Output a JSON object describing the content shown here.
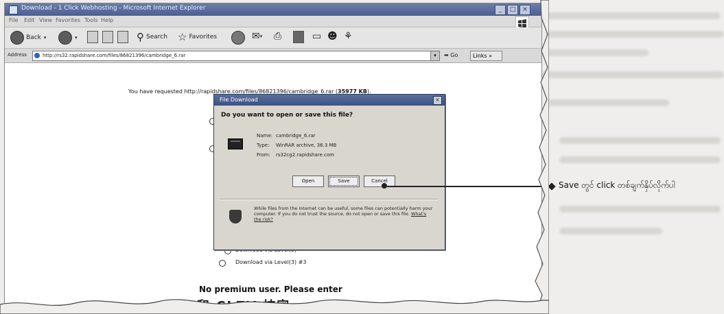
{
  "window": {
    "title": "Download - 1 Click Webhosting - Microsoft Internet Explorer",
    "min": "_",
    "max": "□",
    "close": "×"
  },
  "menu": [
    "File",
    "Edit",
    "View",
    "Favorites",
    "Tools",
    "Help"
  ],
  "toolbar": {
    "back": "Back",
    "search": "Search",
    "favorites": "Favorites"
  },
  "address": {
    "label": "Address",
    "url": "http://rs32.rapidshare.com/files/86821396/cambridge_6.rar",
    "go": "Go",
    "links": "Links"
  },
  "page": {
    "requested_prefix": "You have requested http://rapidshare.com/files/86821396/cambridge_6.rar (",
    "requested_size": "35977 KB",
    "requested_suffix": ").",
    "option_level3": "Download via Level(3)",
    "option_level3_3": "Download via Level(3) #3",
    "premium_notice": "No premium user. Please enter",
    "captcha": "和 CLZV 抹字"
  },
  "dialog": {
    "title": "File Download",
    "close": "×",
    "question": "Do you want to open or save this file?",
    "name_label": "Name:",
    "name_value": "cambridge_6.rar",
    "type_label": "Type:",
    "type_value": "WinRAR archive, 36.3 MB",
    "from_label": "From:",
    "from_value": "rs32cg2.rapidshare.com",
    "open_button": "Open",
    "save_button": "Save",
    "cancel_button": "Cancel",
    "warning": "While files from the Internet can be useful, some files can potentially harm your computer. If you do not trust the source, do not open or save this file.",
    "warning_link": "What's the risk?"
  },
  "annotation": {
    "text": "Save တွင် click တစ်ချက်နှိပ်လိုက်ပါ"
  }
}
